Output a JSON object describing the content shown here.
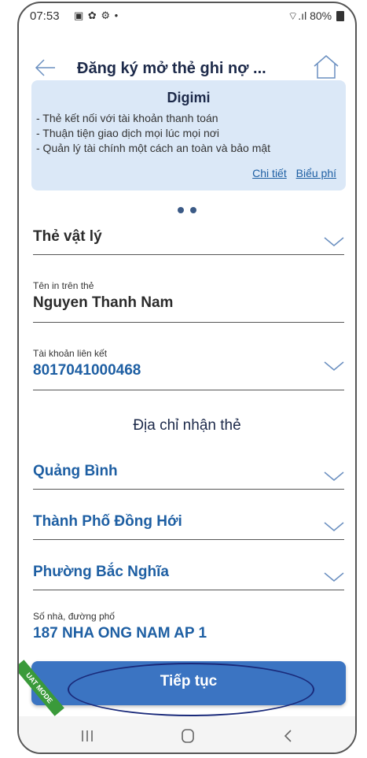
{
  "status": {
    "time": "07:53",
    "left_icons": "▣ ✿ ⚙ •",
    "signal": "⌔.ıl",
    "battery": "80%"
  },
  "header": {
    "title": "Đăng ký mở thẻ ghi nợ ..."
  },
  "card": {
    "title": "Digimi",
    "lines": [
      "- Thẻ kết nối với tài khoản thanh toán",
      "- Thuận tiện giao dịch mọi lúc mọi nơi",
      "- Quản lý tài chính một cách an toàn và bảo mật"
    ],
    "link_detail": "Chi tiết",
    "link_fee": "Biểu phí"
  },
  "form": {
    "card_type": "Thẻ vật lý",
    "name_label": "Tên in trên thẻ",
    "name_value": "Nguyen Thanh Nam",
    "account_label": "Tài khoản liên kết",
    "account_value": "8017041000468",
    "address_title": "Địa chỉ nhận thẻ",
    "province": "Quảng Bình",
    "district": "Thành Phố Đồng Hới",
    "ward": "Phường Bắc Nghĩa",
    "street_label": "Số nhà, đường phố",
    "street_value": "187 NHA ONG NAM AP 1"
  },
  "actions": {
    "continue_label": "Tiếp tục"
  },
  "badge": {
    "text": "UAT MODE"
  },
  "colors": {
    "primary": "#3b74c2",
    "card_bg": "#dbe8f7",
    "link": "#1e5fa3",
    "title": "#1d2a4a"
  }
}
